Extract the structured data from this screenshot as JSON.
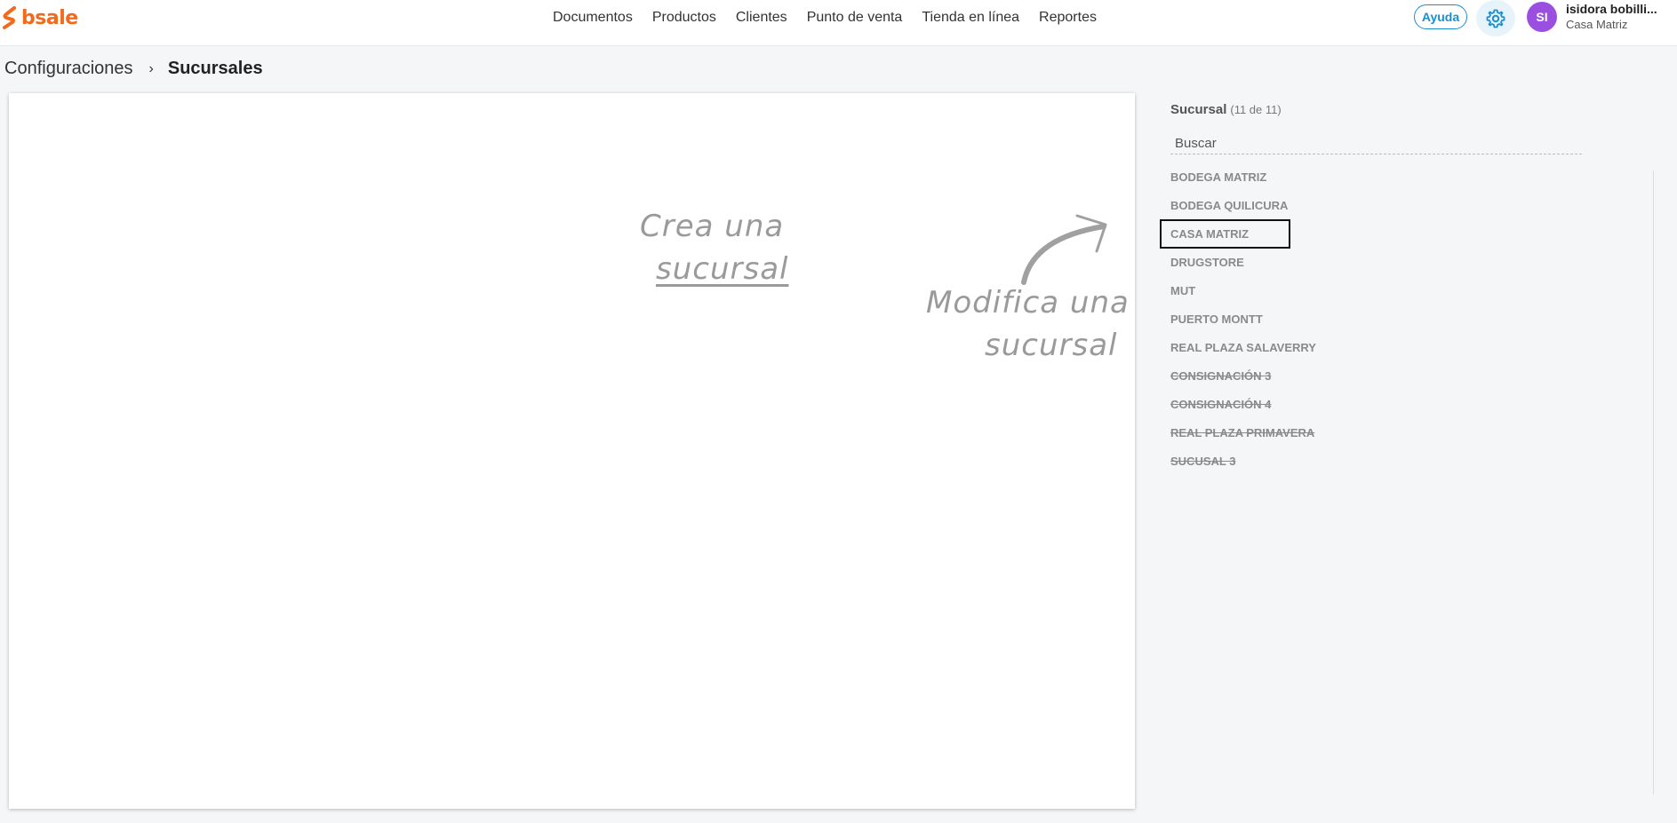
{
  "header": {
    "logo_text": "bsale",
    "nav": [
      "Documentos",
      "Productos",
      "Clientes",
      "Punto de venta",
      "Tienda en línea",
      "Reportes"
    ],
    "help_label": "Ayuda",
    "avatar_initials": "SI",
    "user_name": "isidora bobilli...",
    "user_branch": "Casa Matriz",
    "brand_color": "#f26b1d",
    "accent_color": "#1d8fcf"
  },
  "breadcrumb": {
    "parent": "Configuraciones",
    "current": "Sucursales"
  },
  "main": {
    "create_line1": "Crea una",
    "create_line2": "sucursal",
    "modify_line1": "Modifica una",
    "modify_line2": "sucursal"
  },
  "sidebar": {
    "title": "Sucursal",
    "count": "(11 de 11)",
    "search_placeholder": "Buscar",
    "branches": [
      {
        "label": "BODEGA MATRIZ",
        "active": true
      },
      {
        "label": "BODEGA QUILICURA",
        "active": true
      },
      {
        "label": "CASA MATRIZ",
        "active": true,
        "selected": true
      },
      {
        "label": "DRUGSTORE",
        "active": true
      },
      {
        "label": "MUT",
        "active": true
      },
      {
        "label": "PUERTO MONTT",
        "active": true
      },
      {
        "label": "REAL PLAZA SALAVERRY",
        "active": true
      },
      {
        "label": "CONSIGNACIÓN 3",
        "active": false
      },
      {
        "label": "CONSIGNACIÓN 4",
        "active": false
      },
      {
        "label": "REAL PLAZA PRIMAVERA",
        "active": false
      },
      {
        "label": "SUCUSAL 3",
        "active": false
      }
    ]
  }
}
